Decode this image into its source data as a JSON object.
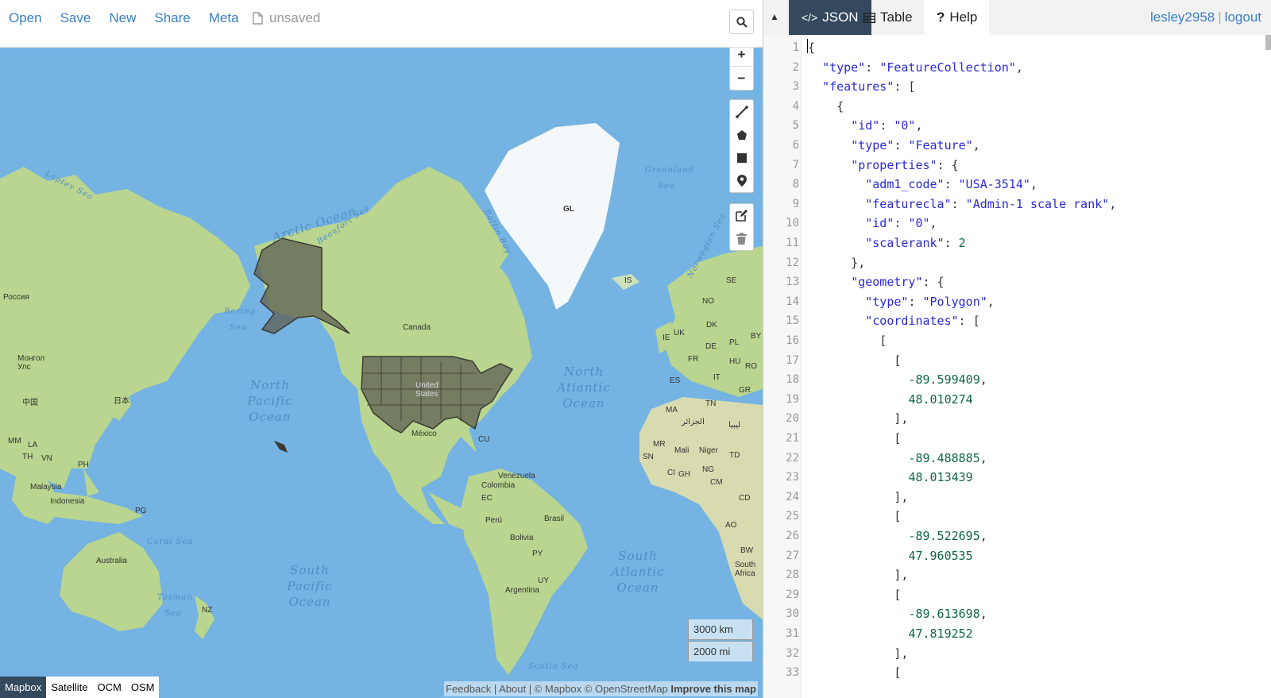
{
  "toolbar": {
    "menu": [
      "Open",
      "Save",
      "New",
      "Share",
      "Meta"
    ],
    "file_status": "unsaved"
  },
  "map": {
    "ocean_labels": {
      "arctic": "Arctic Ocean",
      "north_pacific": [
        "North",
        "Pacific",
        "Ocean"
      ],
      "north_atlantic": [
        "North",
        "Atlantic",
        "Ocean"
      ],
      "south_pacific": [
        "South",
        "Pacific",
        "Ocean"
      ],
      "south_atlantic": [
        "South",
        "Atlantic",
        "Ocean"
      ],
      "laptev": "Laptev Sea",
      "beaufort": "Beaufort Sea",
      "baffin": "Baffin Bay",
      "greenland_sea": "Greenland Sea",
      "norwegian": "Norwegian Sea",
      "bering": "Bering Sea",
      "coral": "Coral Sea",
      "tasman": "Tasman Sea",
      "scotia": "Scotia Sea"
    },
    "places": {
      "gl": "GL",
      "is": "IS",
      "canada": "Canada",
      "russia": "Россия",
      "mongolia": "Монгол Улс",
      "china": "中国",
      "japan": "日本",
      "us": "United States",
      "mexico": "México",
      "cu": "CU",
      "venezuela": "Venezuela",
      "colombia": "Colombia",
      "ec": "EC",
      "peru": "Perú",
      "brasil": "Brasil",
      "bolivia": "Bolivia",
      "py": "PY",
      "argentina": "Argentina",
      "uy": "UY",
      "australia": "Australia",
      "nz": "NZ",
      "pg": "PG",
      "malaysia": "Malaysia",
      "indonesia": "Indonesia",
      "ph": "PH",
      "mm": "MM",
      "la": "LA",
      "th": "TH",
      "vn": "VN",
      "uk": "UK",
      "ie": "IE",
      "fr": "FR",
      "es": "ES",
      "it": "IT",
      "de": "DE",
      "pl": "PL",
      "no": "NO",
      "se": "SE",
      "dk": "DK",
      "by": "BY",
      "hu": "HU",
      "ro": "RO",
      "gr": "GR",
      "ma": "MA",
      "tn": "TN",
      "dz": "الجزائر",
      "ly": "ليبيا",
      "mr": "MR",
      "mali": "Mali",
      "niger": "Niger",
      "td": "TD",
      "sn": "SN",
      "ci": "CI",
      "gh": "GH",
      "ng": "NG",
      "cm": "CM",
      "cd": "CD",
      "ao": "AO",
      "bw": "BW",
      "za": "South Africa"
    },
    "scale_km": "3000 km",
    "scale_mi": "2000 mi",
    "layers": [
      "Mapbox",
      "Satellite",
      "OCM",
      "OSM"
    ],
    "active_layer": "Mapbox",
    "attribution": {
      "feedback": "Feedback",
      "about": "About",
      "mapbox": "© Mapbox",
      "osm": "© OpenStreetMap",
      "improve": "Improve this map"
    }
  },
  "panel": {
    "tabs": [
      {
        "label": "JSON",
        "icon": "code-icon",
        "active": true
      },
      {
        "label": "Table",
        "icon": "table-icon",
        "active": false
      },
      {
        "label": "Help",
        "icon": "question-icon",
        "active": false
      }
    ],
    "user": "lesley2958",
    "logout": "logout"
  },
  "code_lines": [
    "{",
    "  \"type\": \"FeatureCollection\",",
    "  \"features\": [",
    "    {",
    "      \"id\": \"0\",",
    "      \"type\": \"Feature\",",
    "      \"properties\": {",
    "        \"adm1_code\": \"USA-3514\",",
    "        \"featurecla\": \"Admin-1 scale rank\",",
    "        \"id\": \"0\",",
    "        \"scalerank\": 2",
    "      },",
    "      \"geometry\": {",
    "        \"type\": \"Polygon\",",
    "        \"coordinates\": [",
    "          [",
    "            [",
    "              -89.599409,",
    "              48.010274",
    "            ],",
    "            [",
    "              -89.488885,",
    "              48.013439",
    "            ],",
    "            [",
    "              -89.522695,",
    "              47.960535",
    "            ],",
    "            [",
    "              -89.613698,",
    "              47.819252",
    "            ],",
    "            ["
  ],
  "colors": {
    "accent": "#3c7fc1",
    "tab_active": "#34495e",
    "ocean": "#74b3e2",
    "land": "#b9d58f",
    "feature": "#5e5e52"
  }
}
